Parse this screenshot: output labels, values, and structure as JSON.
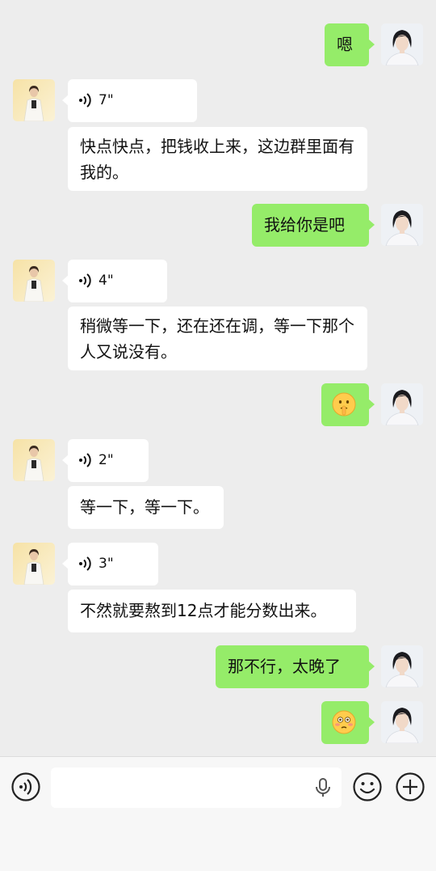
{
  "messages": [
    {
      "side": "self",
      "type": "text",
      "text": "嗯"
    },
    {
      "side": "other",
      "type": "voice",
      "duration": "7\""
    },
    {
      "side": "other",
      "type": "text",
      "text": "快点快点，把钱收上来，这边群里面有我的。"
    },
    {
      "side": "self",
      "type": "text",
      "text": "我给你是吧"
    },
    {
      "side": "other",
      "type": "voice",
      "duration": "4\""
    },
    {
      "side": "other",
      "type": "text",
      "text": "稍微等一下，还在还在调，等一下那个人又说没有。"
    },
    {
      "side": "self",
      "type": "emoji",
      "emoji": "shushing-face-icon"
    },
    {
      "side": "other",
      "type": "voice",
      "duration": "2\""
    },
    {
      "side": "other",
      "type": "text",
      "text": "等一下，等一下。"
    },
    {
      "side": "other",
      "type": "voice",
      "duration": "3\""
    },
    {
      "side": "other",
      "type": "text",
      "text": "不然就要熬到12点才能分数出来。"
    },
    {
      "side": "self",
      "type": "text",
      "text": "那不行，太晚了"
    },
    {
      "side": "self",
      "type": "emoji",
      "emoji": "flushed-face-icon"
    }
  ],
  "input_bar": {
    "placeholder": "",
    "icons": [
      "voice-input-icon",
      "microphone-icon",
      "emoji-icon",
      "plus-icon"
    ]
  },
  "colors": {
    "background": "#ededed",
    "self_bubble": "#95ec69",
    "other_bubble": "#ffffff"
  }
}
